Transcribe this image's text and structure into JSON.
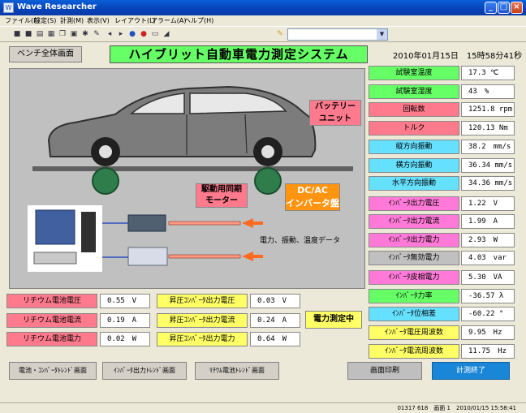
{
  "window": {
    "title": "Wave Researcher",
    "minimize": "_",
    "maximize": "□",
    "close": "×"
  },
  "menu": [
    {
      "label": "ファイル(F)"
    },
    {
      "label": "設定(S)"
    },
    {
      "label": "計測(M)"
    },
    {
      "label": "表示(V)"
    },
    {
      "label": "レイアウト(L)"
    },
    {
      "label": "アラーム(A)"
    },
    {
      "label": "ヘルプ(H)"
    }
  ],
  "toolbar": {
    "combo_value": "",
    "icons": [
      "stop-icon",
      "stop-icon",
      "open-icon",
      "print-icon",
      "copy-icon",
      "paste-icon",
      "settings-icon",
      "edit-icon",
      "back-icon",
      "forward-icon",
      "zoom-icon",
      "record-icon",
      "window-icon",
      "chart-icon"
    ],
    "pen_icon": "pen-icon"
  },
  "header": {
    "bench_button": "ベンチ全体画面",
    "system_title": "ハイブリット自動車電力測定システム",
    "datetime": "2010年01月15日　15時58分41秒"
  },
  "picture": {
    "battery_label_1": "バッテリー",
    "battery_label_2": "ユニット",
    "motor_label_1": "駆動用同期",
    "motor_label_2": "モーター",
    "inverter_label_1": "DC/AC",
    "inverter_label_2": "インバータ盤",
    "data_label": "電力、振動、温度データ"
  },
  "readouts": [
    {
      "label": "試験室温度",
      "value": "17.3 ℃",
      "color": "#66ff66"
    },
    {
      "label": "試験室湿度",
      "value": "43　%",
      "color": "#66ff66"
    },
    {
      "label": "回転数",
      "value": "1251.8 rpm",
      "color": "#ff7a8c"
    },
    {
      "label": "トルク",
      "value": "120.13 Nm",
      "color": "#ff7a8c"
    },
    {
      "label": "縦方向振動",
      "value": "38.2　mm/s",
      "color": "#66e0ff"
    },
    {
      "label": "横方向振動",
      "value": "36.34 mm/s",
      "color": "#66e0ff"
    },
    {
      "label": "水平方向振動",
      "value": "34.36 mm/s",
      "color": "#66e0ff"
    },
    {
      "label": "ｲﾝﾊﾞｰﾀ出力電圧",
      "value": "1.22　V",
      "color": "#ff7ad8"
    },
    {
      "label": "ｲﾝﾊﾞｰﾀ出力電流",
      "value": "1.99　A",
      "color": "#ff7ad8"
    },
    {
      "label": "ｲﾝﾊﾞｰﾀ出力電力",
      "value": "2.93　W",
      "color": "#ff7ad8"
    },
    {
      "label": "ｲﾝﾊﾞｰﾀ無効電力",
      "value": "4.03　var",
      "color": "#c0c0c0"
    },
    {
      "label": "ｲﾝﾊﾞｰﾀ皮相電力",
      "value": "5.30　VA",
      "color": "#ff7ad8"
    },
    {
      "label": "ｲﾝﾊﾞｰﾀ力率",
      "value": "-36.57 λ",
      "color": "#66ff66"
    },
    {
      "label": "ｲﾝﾊﾞｰﾀ位相差",
      "value": "-60.22 °",
      "color": "#66e0ff"
    },
    {
      "label": "ｲﾝﾊﾞｰﾀ電圧周波数",
      "value": "9.95　Hz",
      "color": "#ffff66"
    },
    {
      "label": "ｲﾝﾊﾞｰﾀ電流周波数",
      "value": "11.75　Hz",
      "color": "#ffff66"
    }
  ],
  "battery": [
    {
      "label": "リチウム電池電圧",
      "value": "0.55　V"
    },
    {
      "label": "リチウム電池電流",
      "value": "0.19　A"
    },
    {
      "label": "リチウム電池電力",
      "value": "0.02　W"
    }
  ],
  "converter": [
    {
      "label": "昇圧ｺﾝﾊﾞｰﾀ出力電圧",
      "value": "0.03　V"
    },
    {
      "label": "昇圧ｺﾝﾊﾞｰﾀ出力電流",
      "value": "0.24　A"
    },
    {
      "label": "昇圧ｺﾝﾊﾞｰﾀ出力電力",
      "value": "0.64　W"
    }
  ],
  "colors": {
    "battery_label": "#ff7a8c",
    "converter_label": "#ffff66"
  },
  "status": {
    "measuring": "電力測定中",
    "bar_text": "01317 618　画面 1　2010/01/15 15:58:41"
  },
  "buttons": {
    "trend_battery_converter": "電池・ｺﾝﾊﾞｰﾀﾄﾚﾝﾄﾞ画面",
    "trend_inverter": "ｲﾝﾊﾞｰﾀ出力ﾄﾚﾝﾄﾞ画面",
    "trend_lithium": "ﾘﾁｳﾑ電池ﾄﾚﾝﾄﾞ画面",
    "print": "画面印刷",
    "end": "計測終了"
  }
}
